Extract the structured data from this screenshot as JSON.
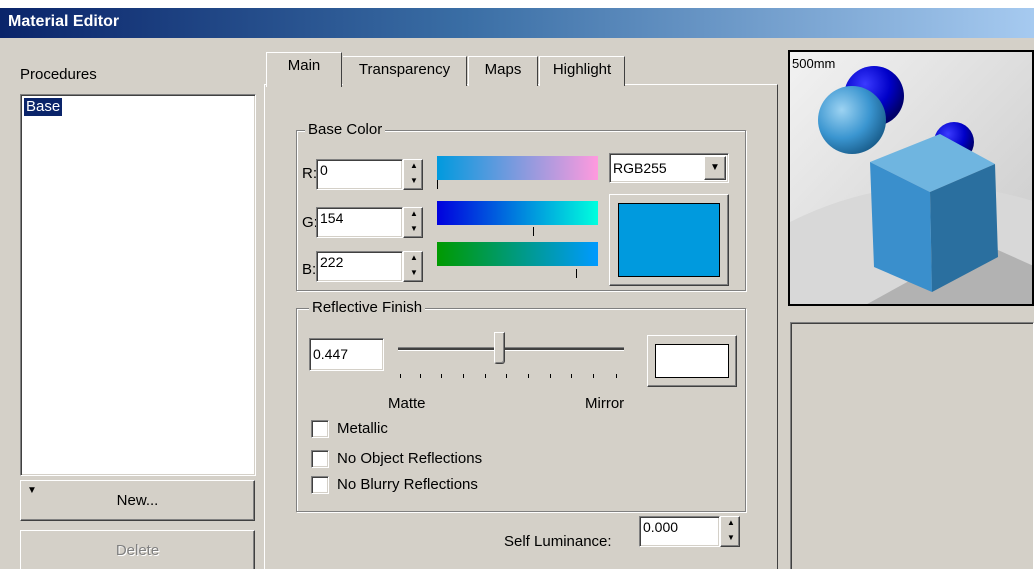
{
  "window": {
    "title": "Material Editor"
  },
  "procedures": {
    "label": "Procedures",
    "items": [
      "Base"
    ],
    "selected": "Base",
    "new_button": "New...",
    "delete_button": "Delete"
  },
  "tabs": [
    {
      "label": "Main",
      "active": true
    },
    {
      "label": "Transparency",
      "active": false
    },
    {
      "label": "Maps",
      "active": false
    },
    {
      "label": "Highlight",
      "active": false
    }
  ],
  "base_color": {
    "label": "Base Color",
    "r_label": "R:",
    "r_value": "0",
    "g_label": "G:",
    "g_value": "154",
    "b_label": "B:",
    "b_value": "222",
    "mode": "RGB255",
    "swatch_color": "#009ade"
  },
  "reflective_finish": {
    "label": "Reflective Finish",
    "value": "0.447",
    "slider_fraction": 0.447,
    "min_label": "Matte",
    "max_label": "Mirror",
    "swatch_color": "#ffffff"
  },
  "options": [
    {
      "label": "Metallic",
      "checked": false
    },
    {
      "label": "No Object Reflections",
      "checked": false
    },
    {
      "label": "No Blurry Reflections",
      "checked": false
    }
  ],
  "self_luminance": {
    "label": "Self Luminance:",
    "value": "0.000"
  },
  "preview": {
    "scale_label": "500mm"
  }
}
